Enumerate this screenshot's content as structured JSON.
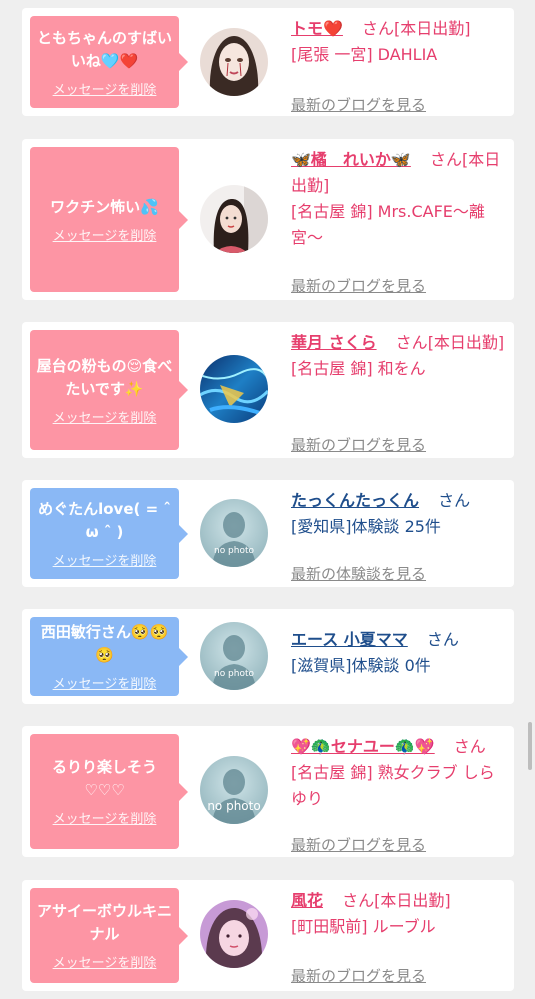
{
  "cards": [
    {
      "message": "ともちゃんのすばいいね🩵❤️",
      "delete_label": "メッセージを削除",
      "name": "トモ❤️",
      "suffix": "さん",
      "status": "[本日出勤]",
      "area_shop": "[尾張 一宮] DAHLIA",
      "link": "最新のブログを見る",
      "avatar_icon": "girl-portrait"
    },
    {
      "message": "ワクチン怖い💦",
      "delete_label": "メッセージを削除",
      "name": "🦋橘　れいか🦋",
      "suffix": "さん",
      "status": "[本日出勤]",
      "area_shop": "[名古屋 錦] Mrs.CAFE〜離宮〜",
      "link": "最新のブログを見る",
      "avatar_icon": "woman-portrait"
    },
    {
      "message": "屋台の粉もの😌食べたいです✨",
      "delete_label": "メッセージを削除",
      "name": "華月 さくら",
      "suffix": "さん",
      "status": "[本日出勤]",
      "area_shop": "[名古屋 錦] 和をん",
      "link": "最新のブログを見る",
      "avatar_icon": "water-photo"
    },
    {
      "message": "めぐたんlove( = ˆ ω ˆ )",
      "delete_label": "メッセージを削除",
      "name": "たっくんたっくん",
      "suffix": "さん",
      "status": "",
      "area_shop": "[愛知県]体験談 25件",
      "link": "最新の体験談を見る",
      "avatar_icon": "no-photo-silhouette"
    },
    {
      "message": "西田敏行さん🥺🥺🥺",
      "delete_label": "メッセージを削除",
      "name": "エース 小夏ママ",
      "suffix": "さん",
      "status": "",
      "area_shop": "[滋賀県]体験談 0件",
      "link": "",
      "avatar_icon": "no-photo-silhouette"
    },
    {
      "message": "るりり楽しそう",
      "message_sub": "♡♡♡",
      "delete_label": "メッセージを削除",
      "name": "💖🦚セナユー🦚💖",
      "suffix": "さん",
      "status": "",
      "area_shop": "[名古屋 錦] 熟女クラブ しらゆり",
      "link": "最新のブログを見る",
      "avatar_icon": "no-photo-silhouette"
    },
    {
      "message": "アサイーボウルキニナル",
      "delete_label": "メッセージを削除",
      "name": "風花",
      "suffix": "さん",
      "status": "[本日出勤]",
      "area_shop": "[町田駅前] ルーブル",
      "link": "最新のブログを見る",
      "avatar_icon": "girl-photo"
    }
  ],
  "no_photo_label": "no photo",
  "colors": {
    "bubble_pink": "#fd95a4",
    "bubble_blue": "#8ab8f5",
    "name_pink": "#e63e6d",
    "name_navy": "#1f4e8c",
    "link_gray": "#8a8a8a",
    "background": "#efefef"
  }
}
